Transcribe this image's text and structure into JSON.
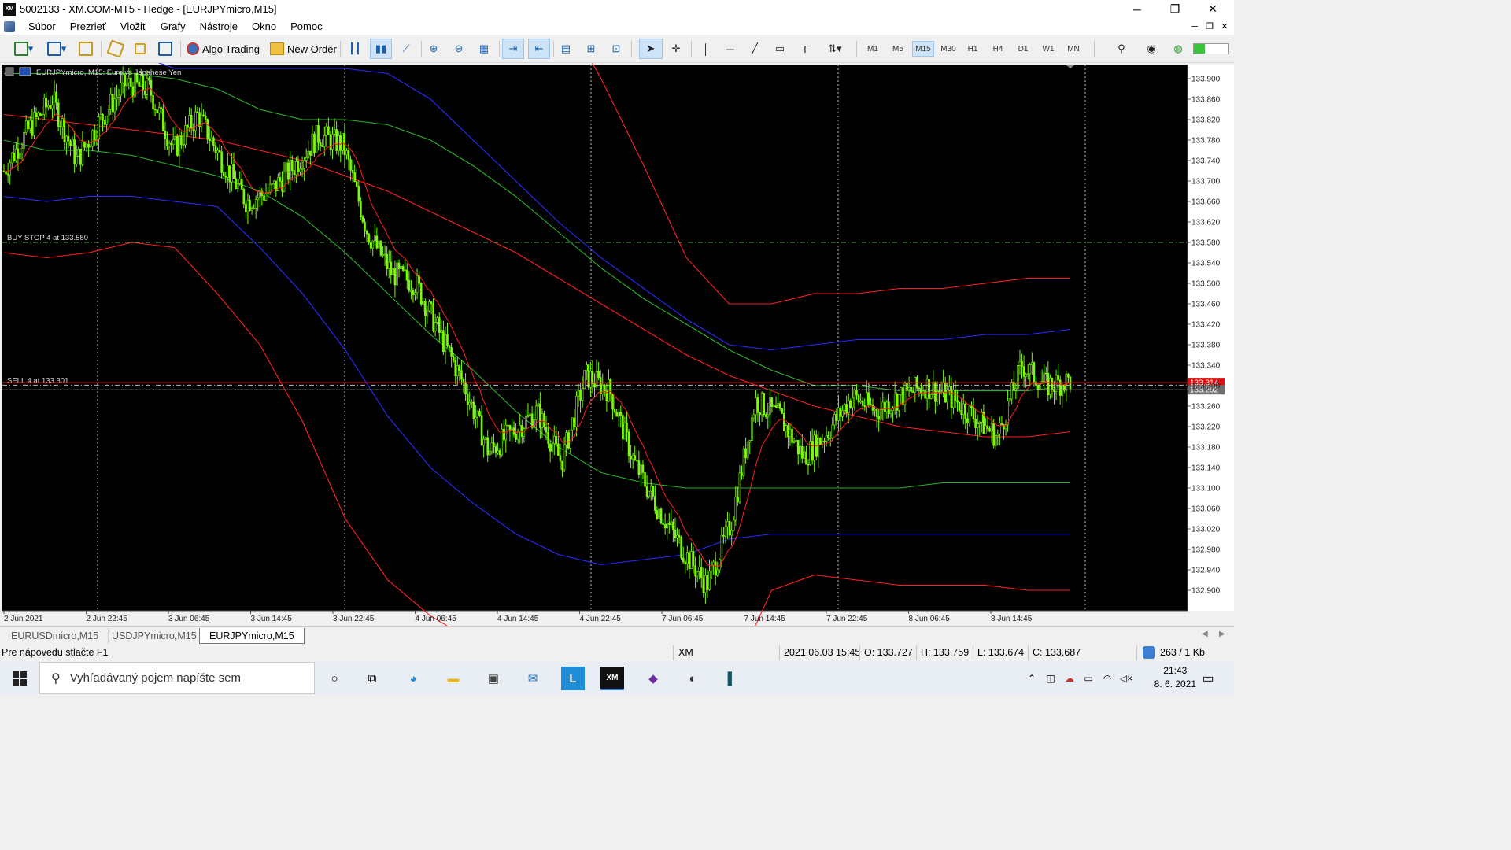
{
  "window": {
    "logo": "XM",
    "title": "5002133 - XM.COM-MT5 - Hedge - [EURJPYmicro,M15]",
    "controls": [
      "─",
      "❐",
      "✕"
    ]
  },
  "menu": {
    "items": [
      "Súbor",
      "Prezrieť",
      "Vložiť",
      "Grafy",
      "Nástroje",
      "Okno",
      "Pomoc"
    ],
    "mdi_controls": [
      "─",
      "❐",
      "✕"
    ]
  },
  "toolbar": {
    "algo_trading": "Algo Trading",
    "new_order": "New Order",
    "timeframes": [
      "M1",
      "M5",
      "M15",
      "M30",
      "H1",
      "H4",
      "D1",
      "W1",
      "MN"
    ],
    "active_timeframe": "M15"
  },
  "chart_data": {
    "type": "candlestick",
    "title": "EURJPYmicro, M15:  Euro vs Japanese Yen",
    "ylim": [
      132.86,
      133.92
    ],
    "y_ticks": [
      "133.900",
      "133.860",
      "133.820",
      "133.780",
      "133.740",
      "133.700",
      "133.660",
      "133.620",
      "133.580",
      "133.540",
      "133.500",
      "133.460",
      "133.420",
      "133.380",
      "133.340",
      "133.300",
      "133.260",
      "133.220",
      "133.180",
      "133.140",
      "133.100",
      "133.060",
      "133.020",
      "132.980",
      "132.940",
      "132.900"
    ],
    "x_ticks": [
      "2 Jun 2021",
      "2 Jun 22:45",
      "3 Jun 06:45",
      "3 Jun 14:45",
      "3 Jun 22:45",
      "4 Jun 06:45",
      "4 Jun 14:45",
      "4 Jun 22:45",
      "7 Jun 06:45",
      "7 Jun 14:45",
      "7 Jun 22:45",
      "8 Jun 06:45",
      "8 Jun 14:45"
    ],
    "price_path": [
      133.72,
      133.8,
      133.86,
      133.74,
      133.82,
      133.89,
      133.88,
      133.76,
      133.83,
      133.74,
      133.66,
      133.68,
      133.73,
      133.79,
      133.77,
      133.6,
      133.52,
      133.5,
      133.4,
      133.3,
      133.17,
      133.21,
      133.25,
      133.15,
      133.32,
      133.29,
      133.15,
      133.06,
      132.98,
      132.91,
      133.03,
      133.27,
      133.24,
      133.16,
      133.21,
      133.28,
      133.25,
      133.28,
      133.3,
      133.28,
      133.24,
      133.2,
      133.34,
      133.3,
      133.31
    ],
    "ask_price": "133.314",
    "bid_price": "133.292",
    "ask_value": 133.306,
    "bid_value": 133.292,
    "orders": [
      {
        "label": "BUY STOP 4 at 133.580",
        "price": 133.58
      },
      {
        "label": "SELL 4 at 133.301",
        "price": 133.301
      }
    ],
    "bands": [
      {
        "color": "#ff2020",
        "values": [
          133.83,
          133.82,
          133.81,
          133.8,
          133.79,
          133.78,
          133.76,
          133.74,
          133.71,
          133.68,
          133.64,
          133.6,
          133.56,
          133.51,
          133.46,
          133.41,
          133.36,
          133.32,
          133.29,
          133.26,
          133.24,
          133.22,
          133.21,
          133.2,
          133.2,
          133.21
        ]
      },
      {
        "color": "#ff2020",
        "values": [
          133.56,
          133.55,
          133.56,
          133.58,
          133.57,
          133.48,
          133.38,
          133.23,
          133.04,
          132.92,
          132.85,
          132.8,
          132.78,
          132.77,
          132.76,
          132.75,
          132.74,
          132.72,
          132.9,
          132.93,
          132.92,
          132.91,
          132.91,
          132.91,
          132.9,
          132.9
        ]
      },
      {
        "color": "#ff2020",
        "values": [
          134.05,
          134.05,
          134.05,
          134.05,
          134.05,
          134.05,
          134.05,
          134.05,
          134.05,
          134.05,
          134.05,
          134.05,
          134.05,
          134.05,
          133.9,
          133.73,
          133.55,
          133.46,
          133.46,
          133.48,
          133.48,
          133.49,
          133.49,
          133.5,
          133.51,
          133.51
        ]
      },
      {
        "color": "#2a2aff",
        "values": [
          133.67,
          133.66,
          133.67,
          133.67,
          133.66,
          133.65,
          133.57,
          133.48,
          133.37,
          133.24,
          133.14,
          133.07,
          133.01,
          132.97,
          132.95,
          132.96,
          132.97,
          133.0,
          133.01,
          133.01,
          133.01,
          133.01,
          133.01,
          133.01,
          133.01,
          133.01
        ]
      },
      {
        "color": "#2a2aff",
        "values": [
          134.0,
          134.0,
          134.0,
          133.95,
          133.92,
          133.92,
          133.92,
          133.92,
          133.92,
          133.91,
          133.86,
          133.78,
          133.7,
          133.62,
          133.55,
          133.49,
          133.43,
          133.38,
          133.37,
          133.38,
          133.39,
          133.39,
          133.39,
          133.4,
          133.4,
          133.41
        ]
      },
      {
        "color": "#2bb32b",
        "values": [
          133.78,
          133.76,
          133.76,
          133.75,
          133.73,
          133.71,
          133.68,
          133.63,
          133.56,
          133.48,
          133.4,
          133.33,
          133.25,
          133.18,
          133.13,
          133.11,
          133.1,
          133.1,
          133.1,
          133.1,
          133.1,
          133.1,
          133.11,
          133.11,
          133.11,
          133.11
        ]
      },
      {
        "color": "#2bb32b",
        "values": [
          133.91,
          133.91,
          133.91,
          133.91,
          133.9,
          133.88,
          133.84,
          133.82,
          133.82,
          133.81,
          133.78,
          133.73,
          133.67,
          133.6,
          133.53,
          133.47,
          133.42,
          133.37,
          133.33,
          133.3,
          133.3,
          133.29,
          133.29,
          133.29,
          133.29,
          133.3
        ]
      }
    ]
  },
  "tabs": [
    "EURUSDmicro,M15",
    "USDJPYmicro,M15",
    "EURJPYmicro,M15"
  ],
  "active_tab": "EURJPYmicro,M15",
  "status": {
    "help": "Pre nápovedu stlačte F1",
    "profile": "XM",
    "datetime": "2021.06.03 15:45",
    "open": "O: 133.727",
    "high": "H: 133.759",
    "low": "L: 133.674",
    "close": "C: 133.687",
    "traffic": "263 / 1 Kb"
  },
  "taskbar": {
    "search_placeholder": "Vyhľadávaný pojem napíšte sem",
    "time": "21:43",
    "date": "8. 6. 2021"
  }
}
